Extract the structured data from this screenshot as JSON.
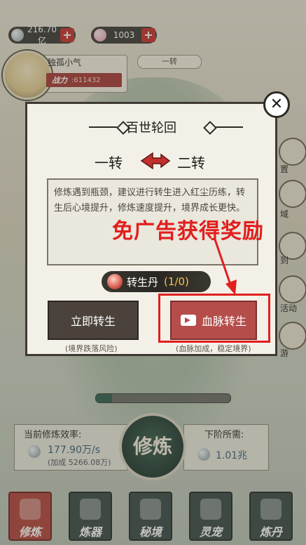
{
  "resources": {
    "spirit_stones": "216.70亿",
    "gems": "1003",
    "plus": "+"
  },
  "player": {
    "name": "独孤小气",
    "power_label": "战力",
    "power_value": ":611432",
    "realm": "一转"
  },
  "side_labels": [
    "置",
    "域",
    "到",
    "活动",
    "游"
  ],
  "modal": {
    "title": "百世轮回",
    "from_turn": "一转",
    "to_turn": "二转",
    "description": "修炼遇到瓶颈，建议进行转生进入红尘历练，转生后心境提升，修炼速度提升，境界成长更快。",
    "item_name": "转生丹",
    "item_count": "(1/0)",
    "btn_now": "立即转生",
    "btn_now_sub": "(境界跌落风险)",
    "btn_blood": "血脉转生",
    "btn_blood_sub": "(血脉加成，稳定境界)",
    "close": "✕"
  },
  "annotation": {
    "text": "免广告获得奖励"
  },
  "cultivation": {
    "rate_title": "当前修炼效率:",
    "rate_value": "177.90万/s",
    "rate_bonus": "(加成 5266.08万)",
    "need_title": "下阶所需:",
    "need_value": "1.01兆",
    "button": "修炼",
    "progress": 0.12
  },
  "nav": [
    {
      "label": "修炼",
      "icon": "cultivate-icon",
      "active": true
    },
    {
      "label": "炼器",
      "icon": "forge-icon",
      "active": false
    },
    {
      "label": "秘境",
      "icon": "realm-icon",
      "active": false
    },
    {
      "label": "灵宠",
      "icon": "pet-icon",
      "active": false
    },
    {
      "label": "炼丹",
      "icon": "alchemy-icon",
      "active": false
    }
  ],
  "colors": {
    "accent_red": "#b54d4a",
    "annotation_red": "#e21e1e",
    "dark": "#2d2a26"
  }
}
